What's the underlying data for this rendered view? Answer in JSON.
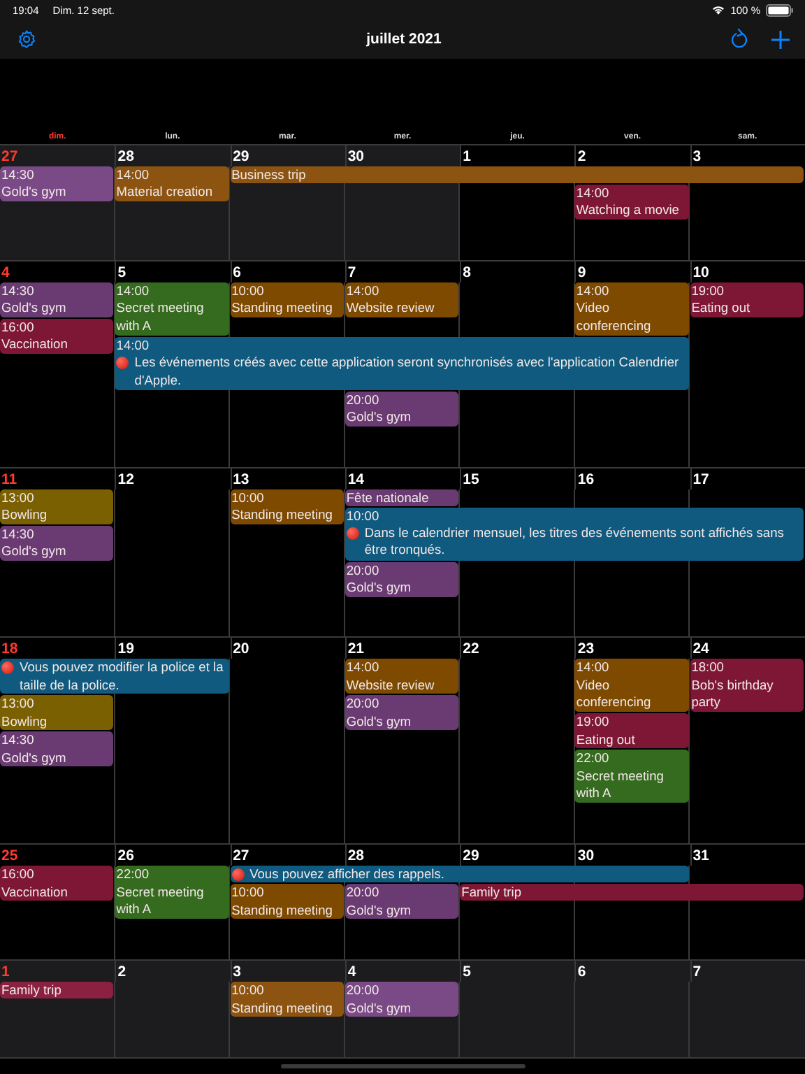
{
  "status_bar": {
    "time": "19:04",
    "date": "Dim. 12 sept.",
    "battery": "100 %"
  },
  "nav": {
    "title": "juillet 2021"
  },
  "weekdays": [
    "dim.",
    "lun.",
    "mar.",
    "mer.",
    "jeu.",
    "ven.",
    "sam."
  ],
  "weeks": [
    {
      "days": [
        {
          "number": "27",
          "in_month": false,
          "events": [
            {
              "kind": "event",
              "time": "14:30",
              "title": "Gold's gym",
              "color": "#7a4a86"
            }
          ]
        },
        {
          "number": "28",
          "in_month": false,
          "events": [
            {
              "kind": "event",
              "time": "14:00",
              "title": "Material creation",
              "color": "#8c5410"
            }
          ]
        },
        {
          "number": "29",
          "in_month": false,
          "events": [
            {
              "kind": "multi_day",
              "title": "Business trip",
              "color": "#8c5410"
            }
          ]
        },
        {
          "number": "30",
          "in_month": false,
          "events": [
            {
              "kind": "continued"
            }
          ]
        },
        {
          "number": "1",
          "in_month": true,
          "events": [
            {
              "kind": "continued"
            }
          ]
        },
        {
          "number": "2",
          "in_month": true,
          "events": [
            {
              "kind": "continued"
            },
            {
              "kind": "event",
              "time": "14:00",
              "title": "Watching a movie",
              "color": "#7e1735"
            }
          ]
        },
        {
          "number": "3",
          "in_month": true,
          "events": [
            {
              "kind": "continued"
            }
          ]
        }
      ]
    },
    {
      "days": [
        {
          "number": "4",
          "in_month": true,
          "events": [
            {
              "kind": "event",
              "time": "14:30",
              "title": "Gold's gym",
              "color": "#6a3b72"
            },
            {
              "kind": "event",
              "time": "16:00",
              "title": "Vaccination",
              "color": "#7e1735"
            }
          ]
        },
        {
          "number": "5",
          "in_month": true,
          "events": [
            {
              "kind": "event",
              "time": "14:00",
              "title": "Secret meeting with A",
              "color": "#356b1f"
            },
            {
              "kind": "note",
              "time": "14:00",
              "title": "Les événements créés avec cette application seront synchronisés avec l'application Calendrier d'Apple.",
              "color": "#0f5a7e"
            }
          ]
        },
        {
          "number": "6",
          "in_month": true,
          "events": [
            {
              "kind": "continued"
            },
            {
              "kind": "event",
              "time": "10:00",
              "title": "Standing meeting",
              "color": "#7e4a00"
            }
          ]
        },
        {
          "number": "7",
          "in_month": true,
          "events": [
            {
              "kind": "continued"
            },
            {
              "kind": "event",
              "time": "14:00",
              "title": "Website review",
              "color": "#7e4a00"
            },
            {
              "kind": "event",
              "time": "20:00",
              "title": "Gold's gym",
              "color": "#6a3b72"
            }
          ]
        },
        {
          "number": "8",
          "in_month": true,
          "events": [
            {
              "kind": "continued"
            }
          ]
        },
        {
          "number": "9",
          "in_month": true,
          "events": [
            {
              "kind": "continued"
            },
            {
              "kind": "event",
              "time": "14:00",
              "title": "Video conferencing",
              "color": "#7e4a00"
            }
          ]
        },
        {
          "number": "10",
          "in_month": true,
          "events": [
            {
              "kind": "event",
              "time": "19:00",
              "title": "Eating out",
              "color": "#7e1735"
            }
          ]
        }
      ]
    },
    {
      "days": [
        {
          "number": "11",
          "in_month": true,
          "events": [
            {
              "kind": "event",
              "time": "13:00",
              "title": "Bowling",
              "color": "#7a6000"
            },
            {
              "kind": "event",
              "time": "14:30",
              "title": "Gold's gym",
              "color": "#6a3b72"
            }
          ]
        },
        {
          "number": "12",
          "in_month": true
        },
        {
          "number": "13",
          "in_month": true,
          "events": [
            {
              "kind": "event",
              "time": "10:00",
              "title": "Standing meeting",
              "color": "#7e4a00"
            }
          ]
        },
        {
          "number": "14",
          "in_month": true,
          "events": [
            {
              "kind": "event",
              "title": "Fête nationale",
              "color": "#6a3b72"
            },
            {
              "kind": "note",
              "time": "10:00",
              "title": "Dans le calendrier mensuel, les titres des événements sont affichés sans être tronqués.",
              "color": "#0f5a7e"
            },
            {
              "kind": "event",
              "time": "20:00",
              "title": "Gold's gym",
              "color": "#6a3b72"
            }
          ]
        },
        {
          "number": "15",
          "in_month": true,
          "events": [
            {
              "kind": "continued"
            }
          ]
        },
        {
          "number": "16",
          "in_month": true,
          "events": [
            {
              "kind": "continued"
            }
          ]
        },
        {
          "number": "17",
          "in_month": true,
          "events": [
            {
              "kind": "continued"
            }
          ]
        }
      ]
    },
    {
      "days": [
        {
          "number": "18",
          "in_month": true,
          "events": [
            {
              "kind": "note",
              "title": "Vous pouvez modifier la police et la taille de la police.",
              "color": "#0f5a7e"
            },
            {
              "kind": "event",
              "time": "13:00",
              "title": "Bowling",
              "color": "#7a6000"
            },
            {
              "kind": "event",
              "time": "14:30",
              "title": "Gold's gym",
              "color": "#6a3b72"
            }
          ]
        },
        {
          "number": "19",
          "in_month": true,
          "events": [
            {
              "kind": "continued"
            }
          ]
        },
        {
          "number": "20",
          "in_month": true
        },
        {
          "number": "21",
          "in_month": true,
          "events": [
            {
              "kind": "event",
              "time": "14:00",
              "title": "Website review",
              "color": "#7e4a00"
            },
            {
              "kind": "event",
              "time": "20:00",
              "title": "Gold's gym",
              "color": "#6a3b72"
            }
          ]
        },
        {
          "number": "22",
          "in_month": true
        },
        {
          "number": "23",
          "in_month": true,
          "events": [
            {
              "kind": "event",
              "time": "14:00",
              "title": "Video conferencing",
              "color": "#7e4a00"
            },
            {
              "kind": "event",
              "time": "19:00",
              "title": "Eating out",
              "color": "#7e1735"
            },
            {
              "kind": "event",
              "time": "22:00",
              "title": "Secret meeting with A",
              "color": "#356b1f"
            }
          ]
        },
        {
          "number": "24",
          "in_month": true,
          "events": [
            {
              "kind": "event",
              "time": "18:00",
              "title": "Bob's birthday party",
              "color": "#7e1735"
            }
          ]
        }
      ]
    },
    {
      "days": [
        {
          "number": "25",
          "in_month": true,
          "events": [
            {
              "kind": "event",
              "time": "16:00",
              "title": "Vaccination",
              "color": "#7e1735"
            }
          ]
        },
        {
          "number": "26",
          "in_month": true,
          "events": [
            {
              "kind": "event",
              "time": "22:00",
              "title": "Secret meeting with A",
              "color": "#356b1f"
            }
          ]
        },
        {
          "number": "27",
          "in_month": true,
          "events": [
            {
              "kind": "note",
              "title": "Vous pouvez afficher des rappels.",
              "color": "#0f5a7e"
            },
            {
              "kind": "event",
              "time": "10:00",
              "title": "Standing meeting",
              "color": "#7e4a00"
            }
          ]
        },
        {
          "number": "28",
          "in_month": true,
          "events": [
            {
              "kind": "continued"
            },
            {
              "kind": "event",
              "time": "20:00",
              "title": "Gold's gym",
              "color": "#6a3b72"
            }
          ]
        },
        {
          "number": "29",
          "in_month": true,
          "events": [
            {
              "kind": "continued"
            },
            {
              "kind": "multi_day",
              "title": "Family trip",
              "color": "#7e1735"
            }
          ]
        },
        {
          "number": "30",
          "in_month": true,
          "events": [
            {
              "kind": "continued"
            },
            {
              "kind": "continued"
            }
          ]
        },
        {
          "number": "31",
          "in_month": true,
          "events": [
            {
              "kind": "continued"
            }
          ]
        }
      ]
    },
    {
      "days": [
        {
          "number": "1",
          "in_month": false,
          "events": [
            {
              "kind": "event",
              "title": "Family trip",
              "color": "#8a2140"
            }
          ]
        },
        {
          "number": "2",
          "in_month": false
        },
        {
          "number": "3",
          "in_month": false,
          "events": [
            {
              "kind": "event",
              "time": "10:00",
              "title": "Standing meeting",
              "color": "#8c5410"
            }
          ]
        },
        {
          "number": "4",
          "in_month": false,
          "events": [
            {
              "kind": "event",
              "time": "20:00",
              "title": "Gold's gym",
              "color": "#7a4a86"
            }
          ]
        },
        {
          "number": "5",
          "in_month": false
        },
        {
          "number": "6",
          "in_month": false
        },
        {
          "number": "7",
          "in_month": false
        }
      ]
    }
  ]
}
